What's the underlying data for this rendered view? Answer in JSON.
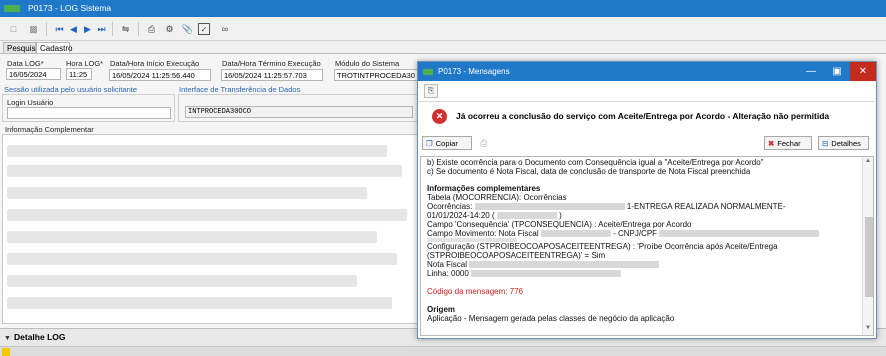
{
  "window": {
    "title": "P0173 - LOG Sistema"
  },
  "tabs": [
    {
      "label": "Pesquisa"
    },
    {
      "label": "Cadastro"
    }
  ],
  "fields": {
    "data_log": {
      "label": "Data LOG*",
      "value": "16/05/2024"
    },
    "hora_log": {
      "label": "Hora LOG*",
      "value": "11:25"
    },
    "inicio": {
      "label": "Data/Hora Início Execução",
      "value": "16/05/2024 11:25:56.440"
    },
    "termino": {
      "label": "Data/Hora Término Execução",
      "value": "16/05/2024 11:25:57.703"
    },
    "modulo": {
      "label": "Módulo do Sistema",
      "value": "TROTINTPROCEDA30"
    },
    "sessao": {
      "label": "Sessão utilizada pelo usuário solicitante"
    },
    "login": {
      "label": "Login Usuário",
      "value": ""
    },
    "interface": {
      "label": "Interface de Transferência de Dados",
      "value": "INTPROCEDA30OCO"
    },
    "complementar": {
      "label": "Informação Complementar"
    }
  },
  "detail": {
    "label": "Detalhe LOG"
  },
  "dialog": {
    "title": "P0173 - Mensagens",
    "headline": "Já ocorreu a conclusão do serviço com Aceite/Entrega por Acordo - Alteração não permitida",
    "buttons": {
      "copy": "Copiar",
      "close": "Fechar",
      "details": "Detalhes"
    },
    "lines": {
      "b": "b) Existe ocorrência para o Documento com Consequência igual a \"Aceite/Entrega por Acordo\"",
      "c": "c) Se documento é Nota Fiscal, data de conclusão de transporte de Nota Fiscal preenchida",
      "info_header": "Informações complementares",
      "tabela": " Tabela (MOCORRENCIA): Ocorrências",
      "ocorrencias_a": " Ocorrências:",
      "ocorrencias_b": "1-ENTREGA REALIZADA NORMALMENTE-",
      "ocorrencias_c": "01/01/2024-14:20 (",
      "ocorrencias_d": ")",
      "consequencia": " Campo 'Consequência' (TPCONSEQUENCIA) : Aceite/Entrega por Acordo",
      "movimento_a": " Campo Movimento: Nota Fiscal",
      "movimento_b": "- CNPJ/CPF",
      "configuracao_a": " Configuração (STPROIBEOCOAPOSACEITEENTREGA) : 'Proíbe Ocorrência após Aceite/Entrega",
      "configuracao_b": "(STPROIBEOCOAPOSACEITEENTREGA)' = Sim",
      "nota_fiscal": " Nota Fiscal",
      "linha": " Linha: 0000",
      "codigo": "Código da mensagem: 776",
      "origem_header": "Origem",
      "origem": "Aplicação - Mensagem gerada pelas classes de negócio da aplicação"
    }
  },
  "colors": {
    "titlebar": "#1f78c8",
    "close": "#c42b1c",
    "error_icon": "#d32f2f",
    "message_code": "#d02020"
  }
}
